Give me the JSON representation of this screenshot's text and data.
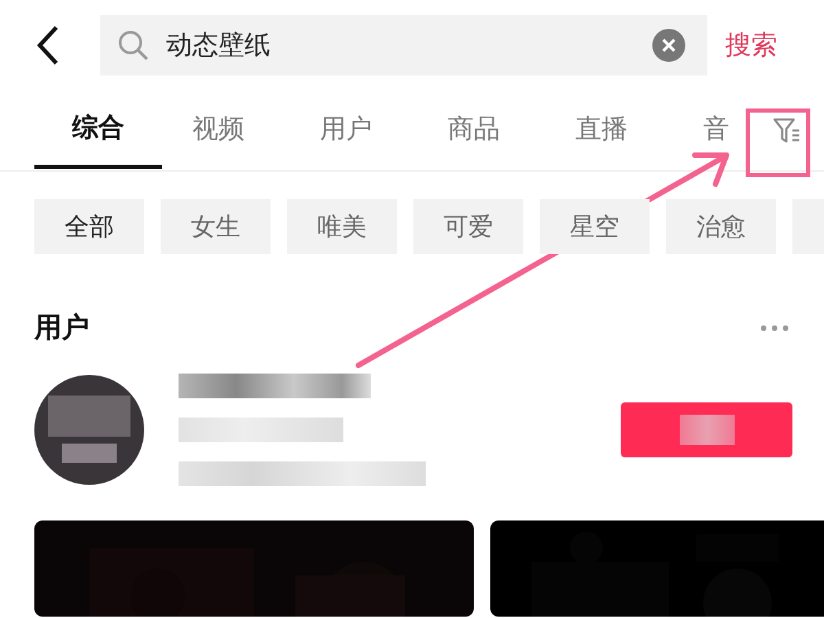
{
  "search": {
    "value": "动态壁纸",
    "button": "搜索"
  },
  "tabs": [
    {
      "label": "综合",
      "selected": true
    },
    {
      "label": "视频",
      "selected": false
    },
    {
      "label": "用户",
      "selected": false
    },
    {
      "label": "商品",
      "selected": false
    },
    {
      "label": "直播",
      "selected": false
    },
    {
      "label": "音",
      "selected": false
    }
  ],
  "chips": [
    {
      "label": "全部",
      "selected": true
    },
    {
      "label": "女生",
      "selected": false
    },
    {
      "label": "唯美",
      "selected": false
    },
    {
      "label": "可爱",
      "selected": false
    },
    {
      "label": "星空",
      "selected": false
    },
    {
      "label": "治愈",
      "selected": false
    }
  ],
  "section": {
    "title": "用户"
  }
}
